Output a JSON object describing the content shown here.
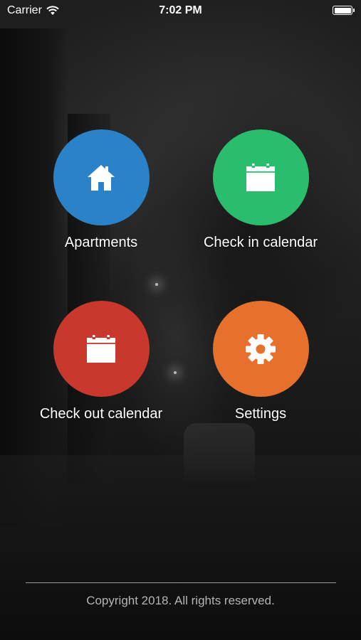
{
  "status_bar": {
    "carrier": "Carrier",
    "time": "7:02 PM",
    "battery_level": 1.0,
    "wifi_icon": "wifi-icon",
    "battery_icon": "battery-icon"
  },
  "menu": {
    "items": [
      {
        "label": "Apartments",
        "icon": "home-icon",
        "color": "#2a82c9"
      },
      {
        "label": "Check in calendar",
        "icon": "calendar-icon",
        "color": "#2bbd6e"
      },
      {
        "label": "Check out calendar",
        "icon": "calendar-icon",
        "color": "#c9382c"
      },
      {
        "label": "Settings",
        "icon": "gear-icon",
        "color": "#e8702d"
      }
    ]
  },
  "footer": {
    "copyright": "Copyright 2018. All rights reserved."
  }
}
